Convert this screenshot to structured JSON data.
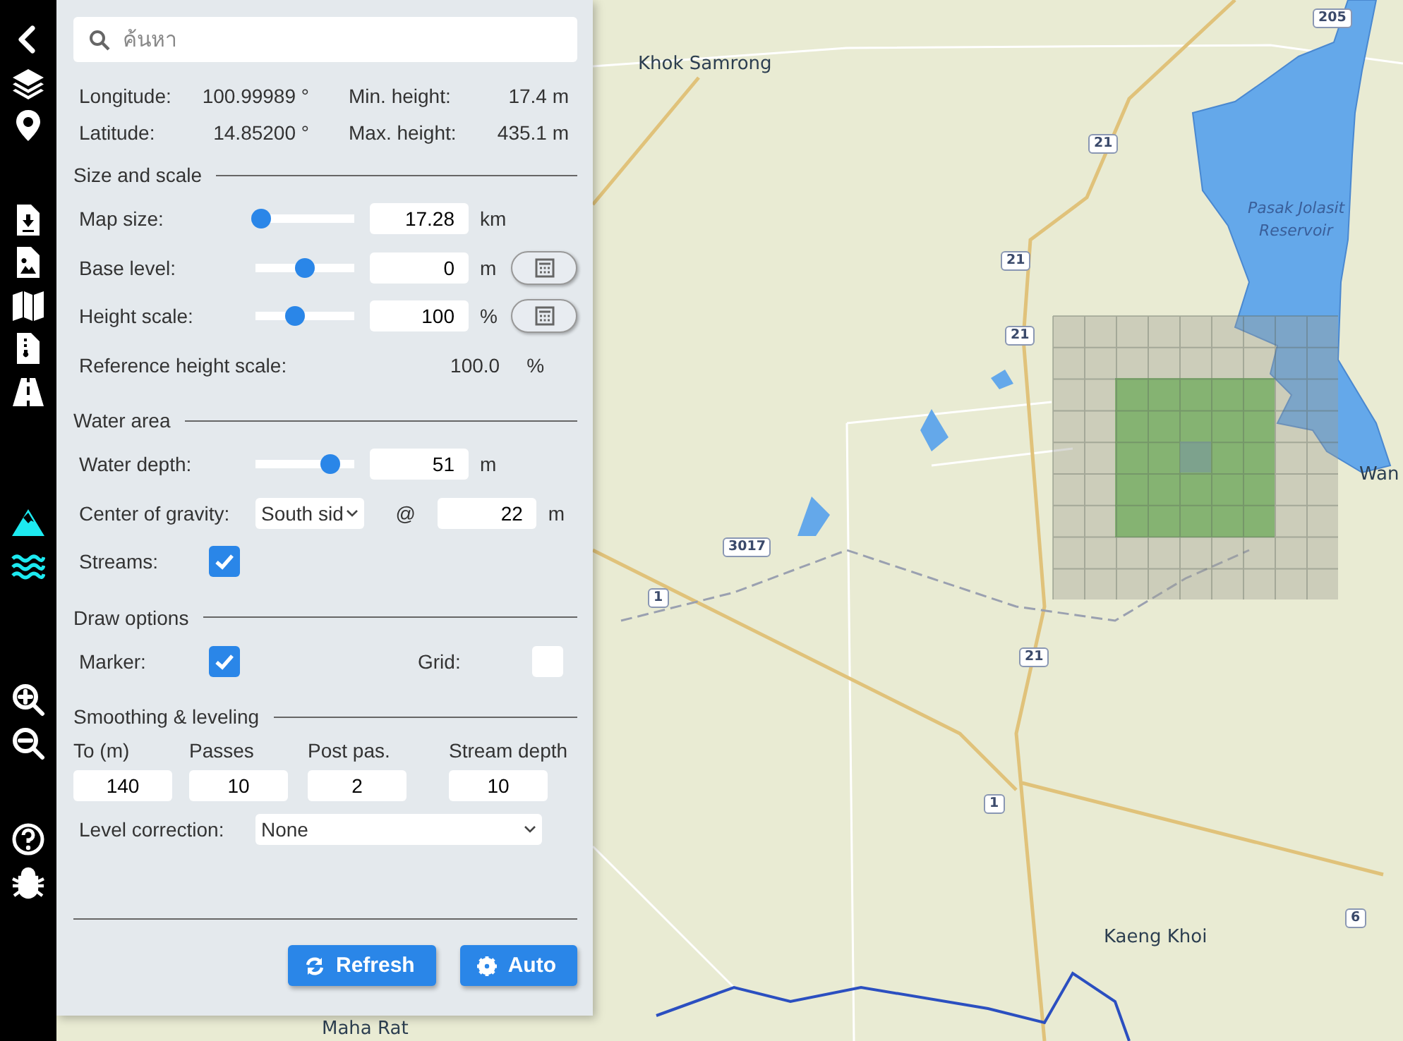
{
  "sidebar": {
    "groups": [
      [
        {
          "kind": "back",
          "selected": false
        },
        {
          "kind": "layers",
          "selected": false
        },
        {
          "kind": "pin",
          "selected": false
        }
      ],
      [
        {
          "kind": "download",
          "selected": false
        },
        {
          "kind": "image",
          "selected": false
        },
        {
          "kind": "map",
          "selected": false
        },
        {
          "kind": "zip",
          "selected": false
        },
        {
          "kind": "road",
          "selected": false
        }
      ],
      [
        {
          "kind": "mountain",
          "selected": true
        },
        {
          "kind": "water",
          "selected": true
        }
      ],
      [
        {
          "kind": "zoom_in",
          "selected": false
        },
        {
          "kind": "zoom_out",
          "selected": false
        }
      ],
      [
        {
          "kind": "help",
          "selected": false
        },
        {
          "kind": "bug",
          "selected": false
        }
      ]
    ]
  },
  "search": {
    "placeholder": "ค้นหา"
  },
  "info": [
    {
      "label": "Longitude:",
      "value": "100.99989 °"
    },
    {
      "label": "Min. height:",
      "value": "17.4 m"
    },
    {
      "label": "Latitude:",
      "value": "14.85200 °"
    },
    {
      "label": "Max. height:",
      "value": "435.1 m"
    }
  ],
  "sections": [
    {
      "title": "Size and scale",
      "rows": [
        {
          "kind": "slider",
          "label": "Map size:",
          "level": 0.05,
          "value": "17.28",
          "unit": "km",
          "calculator": false
        },
        {
          "kind": "slider",
          "label": "Base level:",
          "level": 0.5,
          "value": "0",
          "unit": "m",
          "calculator": true
        },
        {
          "kind": "slider",
          "label": "Height scale:",
          "level": 0.4,
          "value": "100",
          "unit": "%",
          "calculator": true
        },
        {
          "kind": "readout",
          "label": "Reference height scale:",
          "value": "100.0",
          "unit": "%"
        }
      ]
    },
    {
      "title": "Water area",
      "rows": [
        {
          "kind": "slider",
          "label": "Water depth:",
          "level": 0.75,
          "value": "51",
          "unit": "m",
          "calculator": false
        },
        {
          "kind": "select_at",
          "label": "Center of gravity:",
          "option": "South sid",
          "at": "@",
          "value": "22",
          "unit": "m"
        },
        {
          "kind": "checks",
          "items": [
            {
              "label": "Streams:",
              "checked": true
            }
          ]
        }
      ]
    },
    {
      "title": "Draw options",
      "rows": [
        {
          "kind": "checks",
          "items": [
            {
              "label": "Marker:",
              "checked": true
            },
            {
              "label": "Grid:",
              "checked": false
            }
          ]
        }
      ]
    },
    {
      "title": "Smoothing & leveling",
      "rows": [
        {
          "kind": "columns",
          "columns": [
            {
              "label": "To (m)",
              "value": "140"
            },
            {
              "label": "Passes",
              "value": "10"
            },
            {
              "label": "Post pas.",
              "value": "2"
            },
            {
              "label": "Stream depth",
              "value": "10"
            }
          ]
        },
        {
          "kind": "select",
          "label": "Level correction:",
          "option": "None"
        }
      ]
    }
  ],
  "buttons": [
    {
      "kind": "refresh",
      "label": "Refresh"
    },
    {
      "kind": "auto",
      "label": "Auto"
    }
  ],
  "map": {
    "labels": [
      {
        "kind": "place",
        "text": "Khok Samrong"
      },
      {
        "kind": "water",
        "text": "Pasak Jolasit"
      },
      {
        "kind": "water",
        "text": "Reservoir"
      },
      {
        "kind": "place",
        "text": "Wan"
      },
      {
        "kind": "place",
        "text": "Kaeng Khoi"
      },
      {
        "kind": "place",
        "text": "Maha Rat"
      },
      {
        "kind": "road",
        "text": "205"
      },
      {
        "kind": "road",
        "text": "21"
      },
      {
        "kind": "road",
        "text": "21"
      },
      {
        "kind": "road",
        "text": "21"
      },
      {
        "kind": "road",
        "text": "3017"
      },
      {
        "kind": "road",
        "text": "1"
      },
      {
        "kind": "road",
        "text": "21"
      },
      {
        "kind": "road",
        "text": "1"
      },
      {
        "kind": "road",
        "text": "6"
      }
    ]
  }
}
